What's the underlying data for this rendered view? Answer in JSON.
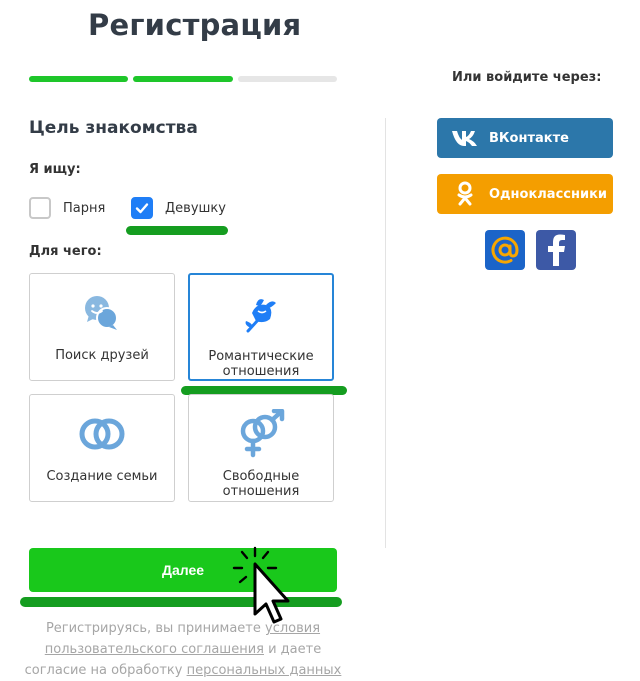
{
  "title": "Регистрация",
  "progress": {
    "total_steps": 3,
    "completed_steps": 2
  },
  "section_title": "Цель знакомства",
  "looking_for": {
    "label": "Я ищу:",
    "options": [
      {
        "label": "Парня",
        "checked": false
      },
      {
        "label": "Девушку",
        "checked": true
      }
    ]
  },
  "purpose": {
    "label": "Для чего:",
    "cards": [
      {
        "label": "Поиск друзей",
        "icon": "chat-bubbles-icon",
        "selected": false
      },
      {
        "label": "Романтические\nотношения",
        "icon": "flower-icon",
        "selected": true
      },
      {
        "label": "Создание семьи",
        "icon": "rings-icon",
        "selected": false
      },
      {
        "label": "Свободные\nотношения",
        "icon": "gender-symbols-icon",
        "selected": false
      }
    ]
  },
  "next_button": "Далее",
  "terms": {
    "part1": "Регистрируясь, вы принимаете ",
    "link1": "условия пользовательского соглашения",
    "part2": " и даете согласие на обработку ",
    "link2": "персональных данных"
  },
  "social": {
    "title": "Или войдите через:",
    "vk_label": "ВКонтакте",
    "ok_label": "Одноклассники"
  },
  "colors": {
    "accent_green": "#19c81b",
    "selected_blue": "#2685d7",
    "vk": "#2c77aa",
    "ok": "#f49e00",
    "mail": "#1b64c8",
    "facebook": "#3d59a6",
    "highlight_mark": "#159d20"
  }
}
